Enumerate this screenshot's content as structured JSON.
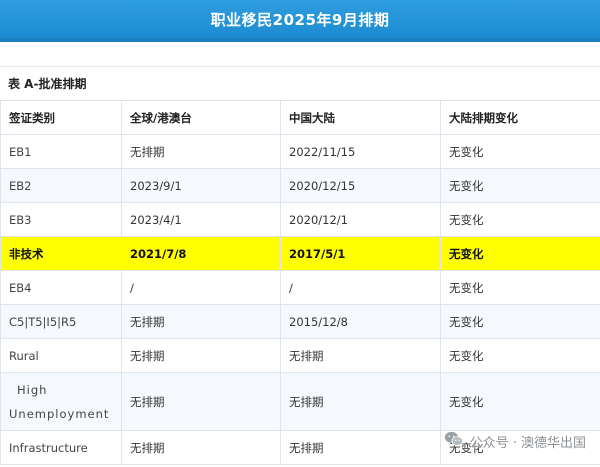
{
  "banner": {
    "title": "职业移民2025年9月排期"
  },
  "table": {
    "caption": "表 A-批准排期",
    "headers": [
      "签证类别",
      "全球/港澳台",
      "中国大陆",
      "大陆排期变化"
    ],
    "rows": [
      {
        "category": "EB1",
        "global": "无排期",
        "china": "2022/11/15",
        "change": "无变化"
      },
      {
        "category": "EB2",
        "global": "2023/9/1",
        "china": "2020/12/15",
        "change": "无变化"
      },
      {
        "category": "EB3",
        "global": "2023/4/1",
        "china": "2020/12/1",
        "change": "无变化"
      },
      {
        "category": "非技术",
        "global": "2021/7/8",
        "china": "2017/5/1",
        "change": "无变化"
      },
      {
        "category": "EB4",
        "global": "/",
        "china": "/",
        "change": "无变化"
      },
      {
        "category": "C5|T5|I5|R5",
        "global": "无排期",
        "china": "2015/12/8",
        "change": "无变化"
      },
      {
        "category": "Rural",
        "global": "无排期",
        "china": "无排期",
        "change": "无变化"
      },
      {
        "category": "High Unemployment",
        "global": "无排期",
        "china": "无排期",
        "change": "无变化"
      },
      {
        "category": "Infrastructure",
        "global": "无排期",
        "china": "无排期",
        "change": "无变化"
      }
    ]
  },
  "watermark": {
    "text": "公众号 · 澳德华出国",
    "icon": "wechat-icon"
  },
  "colors": {
    "banner": "#1d8bd0",
    "highlight": "#ffff00",
    "row_alt": "#f5f8fc",
    "border": "#dfe4ea"
  }
}
